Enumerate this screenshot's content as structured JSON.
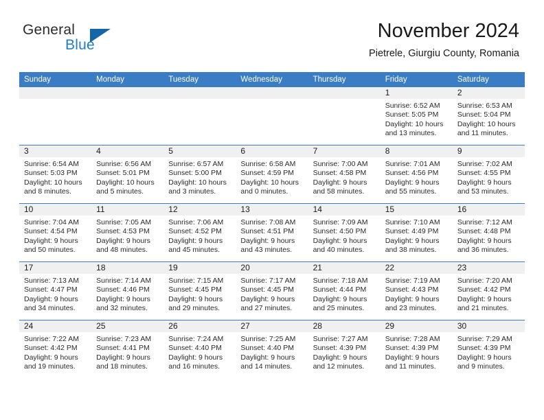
{
  "brand": {
    "name_part1": "General",
    "name_part2": "Blue",
    "logo_icon": "triangle-logo-icon"
  },
  "header": {
    "title": "November 2024",
    "subtitle": "Pietrele, Giurgiu County, Romania"
  },
  "colors": {
    "header_blue": "#3b7dc4",
    "brand_blue": "#1f7ec4",
    "logo_blue": "#1565a8",
    "daynum_band": "#f0f0f0",
    "text": "#1a1a1a"
  },
  "calendar": {
    "weekday_headers": [
      "Sunday",
      "Monday",
      "Tuesday",
      "Wednesday",
      "Thursday",
      "Friday",
      "Saturday"
    ],
    "weeks": [
      [
        {
          "day": "",
          "empty": true,
          "sunrise": "",
          "sunset": "",
          "daylight_line1": "",
          "daylight_line2": ""
        },
        {
          "day": "",
          "empty": true,
          "sunrise": "",
          "sunset": "",
          "daylight_line1": "",
          "daylight_line2": ""
        },
        {
          "day": "",
          "empty": true,
          "sunrise": "",
          "sunset": "",
          "daylight_line1": "",
          "daylight_line2": ""
        },
        {
          "day": "",
          "empty": true,
          "sunrise": "",
          "sunset": "",
          "daylight_line1": "",
          "daylight_line2": ""
        },
        {
          "day": "",
          "empty": true,
          "sunrise": "",
          "sunset": "",
          "daylight_line1": "",
          "daylight_line2": ""
        },
        {
          "day": "1",
          "empty": false,
          "sunrise": "Sunrise: 6:52 AM",
          "sunset": "Sunset: 5:05 PM",
          "daylight_line1": "Daylight: 10 hours",
          "daylight_line2": "and 13 minutes."
        },
        {
          "day": "2",
          "empty": false,
          "sunrise": "Sunrise: 6:53 AM",
          "sunset": "Sunset: 5:04 PM",
          "daylight_line1": "Daylight: 10 hours",
          "daylight_line2": "and 11 minutes."
        }
      ],
      [
        {
          "day": "3",
          "empty": false,
          "sunrise": "Sunrise: 6:54 AM",
          "sunset": "Sunset: 5:03 PM",
          "daylight_line1": "Daylight: 10 hours",
          "daylight_line2": "and 8 minutes."
        },
        {
          "day": "4",
          "empty": false,
          "sunrise": "Sunrise: 6:56 AM",
          "sunset": "Sunset: 5:01 PM",
          "daylight_line1": "Daylight: 10 hours",
          "daylight_line2": "and 5 minutes."
        },
        {
          "day": "5",
          "empty": false,
          "sunrise": "Sunrise: 6:57 AM",
          "sunset": "Sunset: 5:00 PM",
          "daylight_line1": "Daylight: 10 hours",
          "daylight_line2": "and 3 minutes."
        },
        {
          "day": "6",
          "empty": false,
          "sunrise": "Sunrise: 6:58 AM",
          "sunset": "Sunset: 4:59 PM",
          "daylight_line1": "Daylight: 10 hours",
          "daylight_line2": "and 0 minutes."
        },
        {
          "day": "7",
          "empty": false,
          "sunrise": "Sunrise: 7:00 AM",
          "sunset": "Sunset: 4:58 PM",
          "daylight_line1": "Daylight: 9 hours",
          "daylight_line2": "and 58 minutes."
        },
        {
          "day": "8",
          "empty": false,
          "sunrise": "Sunrise: 7:01 AM",
          "sunset": "Sunset: 4:56 PM",
          "daylight_line1": "Daylight: 9 hours",
          "daylight_line2": "and 55 minutes."
        },
        {
          "day": "9",
          "empty": false,
          "sunrise": "Sunrise: 7:02 AM",
          "sunset": "Sunset: 4:55 PM",
          "daylight_line1": "Daylight: 9 hours",
          "daylight_line2": "and 53 minutes."
        }
      ],
      [
        {
          "day": "10",
          "empty": false,
          "sunrise": "Sunrise: 7:04 AM",
          "sunset": "Sunset: 4:54 PM",
          "daylight_line1": "Daylight: 9 hours",
          "daylight_line2": "and 50 minutes."
        },
        {
          "day": "11",
          "empty": false,
          "sunrise": "Sunrise: 7:05 AM",
          "sunset": "Sunset: 4:53 PM",
          "daylight_line1": "Daylight: 9 hours",
          "daylight_line2": "and 48 minutes."
        },
        {
          "day": "12",
          "empty": false,
          "sunrise": "Sunrise: 7:06 AM",
          "sunset": "Sunset: 4:52 PM",
          "daylight_line1": "Daylight: 9 hours",
          "daylight_line2": "and 45 minutes."
        },
        {
          "day": "13",
          "empty": false,
          "sunrise": "Sunrise: 7:08 AM",
          "sunset": "Sunset: 4:51 PM",
          "daylight_line1": "Daylight: 9 hours",
          "daylight_line2": "and 43 minutes."
        },
        {
          "day": "14",
          "empty": false,
          "sunrise": "Sunrise: 7:09 AM",
          "sunset": "Sunset: 4:50 PM",
          "daylight_line1": "Daylight: 9 hours",
          "daylight_line2": "and 40 minutes."
        },
        {
          "day": "15",
          "empty": false,
          "sunrise": "Sunrise: 7:10 AM",
          "sunset": "Sunset: 4:49 PM",
          "daylight_line1": "Daylight: 9 hours",
          "daylight_line2": "and 38 minutes."
        },
        {
          "day": "16",
          "empty": false,
          "sunrise": "Sunrise: 7:12 AM",
          "sunset": "Sunset: 4:48 PM",
          "daylight_line1": "Daylight: 9 hours",
          "daylight_line2": "and 36 minutes."
        }
      ],
      [
        {
          "day": "17",
          "empty": false,
          "sunrise": "Sunrise: 7:13 AM",
          "sunset": "Sunset: 4:47 PM",
          "daylight_line1": "Daylight: 9 hours",
          "daylight_line2": "and 34 minutes."
        },
        {
          "day": "18",
          "empty": false,
          "sunrise": "Sunrise: 7:14 AM",
          "sunset": "Sunset: 4:46 PM",
          "daylight_line1": "Daylight: 9 hours",
          "daylight_line2": "and 32 minutes."
        },
        {
          "day": "19",
          "empty": false,
          "sunrise": "Sunrise: 7:15 AM",
          "sunset": "Sunset: 4:45 PM",
          "daylight_line1": "Daylight: 9 hours",
          "daylight_line2": "and 29 minutes."
        },
        {
          "day": "20",
          "empty": false,
          "sunrise": "Sunrise: 7:17 AM",
          "sunset": "Sunset: 4:45 PM",
          "daylight_line1": "Daylight: 9 hours",
          "daylight_line2": "and 27 minutes."
        },
        {
          "day": "21",
          "empty": false,
          "sunrise": "Sunrise: 7:18 AM",
          "sunset": "Sunset: 4:44 PM",
          "daylight_line1": "Daylight: 9 hours",
          "daylight_line2": "and 25 minutes."
        },
        {
          "day": "22",
          "empty": false,
          "sunrise": "Sunrise: 7:19 AM",
          "sunset": "Sunset: 4:43 PM",
          "daylight_line1": "Daylight: 9 hours",
          "daylight_line2": "and 23 minutes."
        },
        {
          "day": "23",
          "empty": false,
          "sunrise": "Sunrise: 7:20 AM",
          "sunset": "Sunset: 4:42 PM",
          "daylight_line1": "Daylight: 9 hours",
          "daylight_line2": "and 21 minutes."
        }
      ],
      [
        {
          "day": "24",
          "empty": false,
          "sunrise": "Sunrise: 7:22 AM",
          "sunset": "Sunset: 4:42 PM",
          "daylight_line1": "Daylight: 9 hours",
          "daylight_line2": "and 19 minutes."
        },
        {
          "day": "25",
          "empty": false,
          "sunrise": "Sunrise: 7:23 AM",
          "sunset": "Sunset: 4:41 PM",
          "daylight_line1": "Daylight: 9 hours",
          "daylight_line2": "and 18 minutes."
        },
        {
          "day": "26",
          "empty": false,
          "sunrise": "Sunrise: 7:24 AM",
          "sunset": "Sunset: 4:40 PM",
          "daylight_line1": "Daylight: 9 hours",
          "daylight_line2": "and 16 minutes."
        },
        {
          "day": "27",
          "empty": false,
          "sunrise": "Sunrise: 7:25 AM",
          "sunset": "Sunset: 4:40 PM",
          "daylight_line1": "Daylight: 9 hours",
          "daylight_line2": "and 14 minutes."
        },
        {
          "day": "28",
          "empty": false,
          "sunrise": "Sunrise: 7:27 AM",
          "sunset": "Sunset: 4:39 PM",
          "daylight_line1": "Daylight: 9 hours",
          "daylight_line2": "and 12 minutes."
        },
        {
          "day": "29",
          "empty": false,
          "sunrise": "Sunrise: 7:28 AM",
          "sunset": "Sunset: 4:39 PM",
          "daylight_line1": "Daylight: 9 hours",
          "daylight_line2": "and 11 minutes."
        },
        {
          "day": "30",
          "empty": false,
          "sunrise": "Sunrise: 7:29 AM",
          "sunset": "Sunset: 4:39 PM",
          "daylight_line1": "Daylight: 9 hours",
          "daylight_line2": "and 9 minutes."
        }
      ]
    ]
  }
}
